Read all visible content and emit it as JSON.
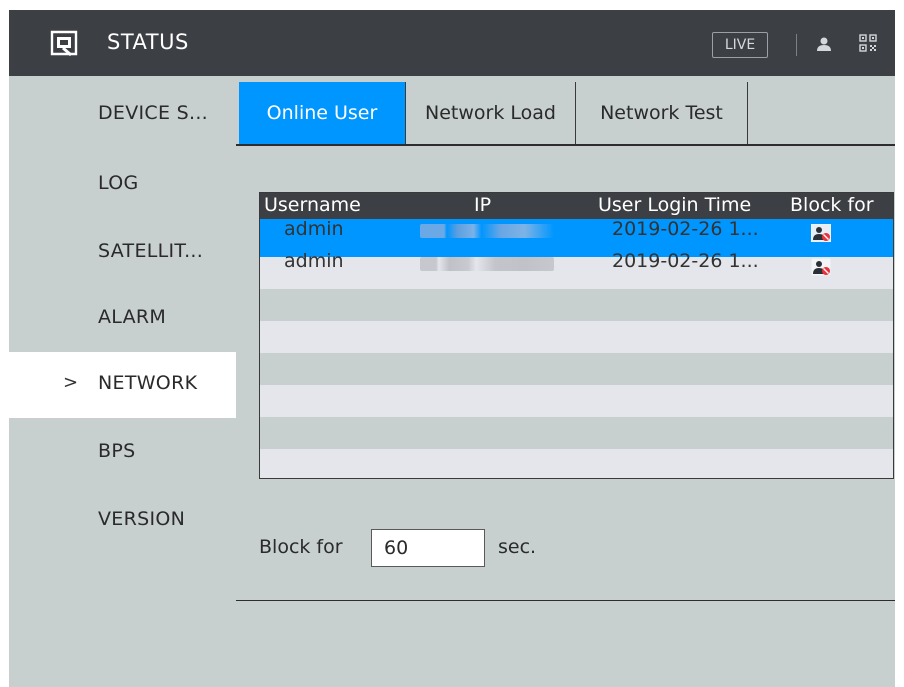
{
  "header": {
    "title": "STATUS",
    "live_label": "LIVE",
    "icons": [
      "logo-icon",
      "user-icon",
      "qr-code-icon"
    ]
  },
  "sidebar": {
    "items": [
      {
        "label": "DEVICE S...",
        "active": false
      },
      {
        "label": "LOG",
        "active": false
      },
      {
        "label": "SATELLIT...",
        "active": false
      },
      {
        "label": "ALARM",
        "active": false
      },
      {
        "label": "NETWORK",
        "active": true,
        "chevron": ">"
      },
      {
        "label": "BPS",
        "active": false
      },
      {
        "label": "VERSION",
        "active": false
      }
    ]
  },
  "tabs": [
    {
      "label": "Online User",
      "active": true
    },
    {
      "label": "Network Load",
      "active": false
    },
    {
      "label": "Network Test",
      "active": false
    }
  ],
  "table": {
    "headers": [
      "Username",
      "IP",
      "User Login Time",
      "Block for"
    ],
    "rows": [
      {
        "username": "admin",
        "ip": "",
        "login_time": "2019-02-26 1...",
        "block_icon": "block-user-icon",
        "selected": true
      },
      {
        "username": "admin",
        "ip": "",
        "login_time": "2019-02-26 1...",
        "block_icon": "block-user-icon",
        "selected": false
      }
    ]
  },
  "block": {
    "label": "Block for",
    "value": "60",
    "unit": "sec."
  },
  "colors": {
    "accent": "#0096ff",
    "header_bg": "#3c3f43",
    "panel_bg": "#c8cfcf",
    "alt_row": "#e4e6ec"
  }
}
